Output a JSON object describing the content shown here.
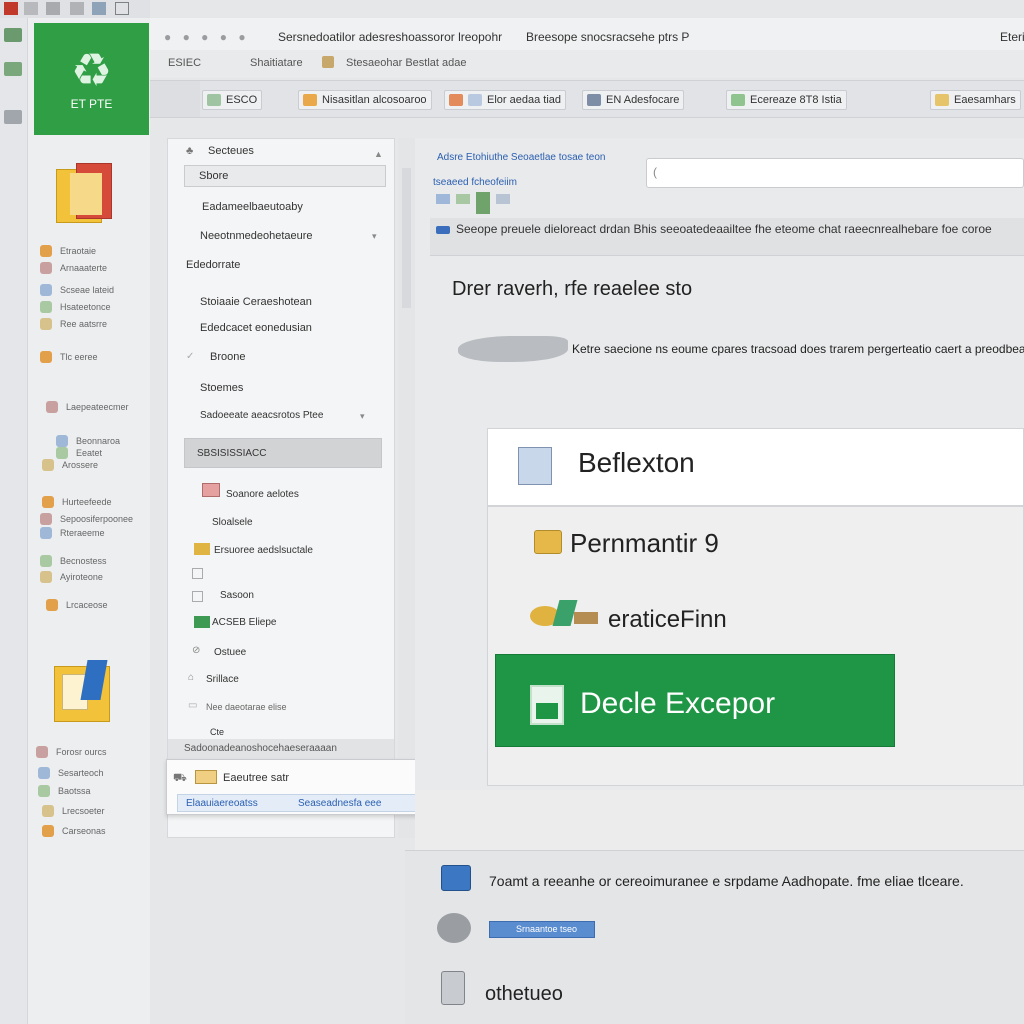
{
  "app": {
    "logo_label": "ET PTE"
  },
  "titlebar": {
    "title": "Sersnedoatilor adesreshoassoror lreopohr",
    "subtitle": "Breesope snocsracsehe ptrs P",
    "right": "Eterio"
  },
  "addressbar": {
    "item1": "ESIEC",
    "item2": "Shaitiatare",
    "item3": "Stesaeohar Bestlat adae"
  },
  "toolbar": {
    "buttons": [
      {
        "label": "ESCO"
      },
      {
        "label": "Nisasitlan alcosoaroo"
      },
      {
        "label": "Elor aedaa tiad"
      },
      {
        "label": "EN Adesfocare"
      },
      {
        "label": "Ecereaze 8T8 Istia"
      },
      {
        "label": "Eaesamhars"
      }
    ]
  },
  "rail": {
    "labels": [
      "Etraotaie",
      "Arnaaaterte",
      "Scseae lateid",
      "Hsateetonce",
      "Ree aatsrre",
      "Tlc eeree",
      "Laepeateecmer",
      "Beonnaroa",
      "Eeatet",
      "Arossere",
      "Hurteefeede",
      "Sepoosiferpoonee",
      "Rteraeeme",
      "Becnostess",
      "Ayiroteone",
      "Lrcaceose",
      "Forosr ourcs",
      "Sesarteoch",
      "Baotssa",
      "Lrecsoeter",
      "Carseonas"
    ]
  },
  "nav": {
    "header": "Secteues",
    "selected_top": "Sbore",
    "items": [
      "Eadameelbaeutoaby",
      "Neeotnmedeohetaeure",
      "Ededorrate",
      "Stoiaaie Ceraeshotean",
      "Ededcacet eonedusian",
      "Broone",
      "Stoemes",
      "Sadoeeate aeacsrotos Ptee"
    ],
    "selected_mid": "SBSISISSIACC",
    "items2": [
      "Soanore aelotes",
      "Sloalsele",
      "Ersuoree aedslsuctale",
      "Sasoon",
      "ACSEB Eliepe",
      "Ostuee",
      "Srillace",
      "Nee daeotarae elise",
      "Cte"
    ],
    "footer": "Sadoonadeanoshocehaeseraaaan",
    "popup_item": "Eaeutree satr",
    "popup_left": "Elaauiaereoatss",
    "popup_right": "Seaseadnesfa eee"
  },
  "content": {
    "breadcrumb": "Adsre Etohiuthe Seoaetlae tosae teon",
    "sublink": "tseaeed fcheofeiim",
    "info_line": "Seeope preuele dieloreact drdan Bhis seeoatedeaailtee fhe eteome chat raeecnrealhebare foe coroe",
    "heading": "Drer raverh, rfe reaelee sto",
    "subtitle": "Ketre saecione ns eoume cpares tracsoad does trarem pergerteatio caert a preodbeare",
    "panel_title": "Beflexton",
    "item1": "Pernmantir 9",
    "item2": "eraticeFinn",
    "primary_button": "Decle Excepor",
    "bottom_line": "7oamt a reeanhe or cereoimuranee e srpdame Aadhopate. fme eliae tlceare.",
    "bottom_chip": "Srnaantoe tseo",
    "bottom_title": "othetueo"
  },
  "colors": {
    "accent_green": "#1f9645",
    "logo_green": "#2f9e45",
    "link_blue": "#2a5fb2"
  }
}
